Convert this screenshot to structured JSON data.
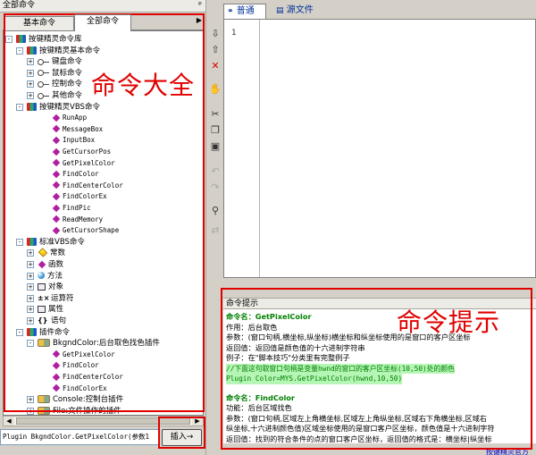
{
  "left_panel": {
    "title": "全部命令",
    "pin": "ᵖ",
    "tabs": [
      "基本命令",
      "全部命令"
    ],
    "tab_arrow": "▶"
  },
  "tree": [
    {
      "label": "按键精灵命令库",
      "level": 0,
      "icon": "multi",
      "exp": "-"
    },
    {
      "label": "按键精灵基本命令",
      "level": 1,
      "icon": "multi",
      "exp": "-"
    },
    {
      "label": "键盘命令",
      "level": 2,
      "icon": "key",
      "exp": "+"
    },
    {
      "label": "鼠标命令",
      "level": 2,
      "icon": "key",
      "exp": "+"
    },
    {
      "label": "控制命令",
      "level": 2,
      "icon": "key",
      "exp": "+"
    },
    {
      "label": "其他命令",
      "level": 2,
      "icon": "key",
      "exp": "+"
    },
    {
      "label": "按键精灵VBS命令",
      "level": 1,
      "icon": "multi",
      "exp": "-"
    },
    {
      "label": "RunApp",
      "level": 3,
      "icon": "diamond",
      "mono": true
    },
    {
      "label": "MessageBox",
      "level": 3,
      "icon": "diamond",
      "mono": true
    },
    {
      "label": "InputBox",
      "level": 3,
      "icon": "diamond",
      "mono": true
    },
    {
      "label": "GetCursorPos",
      "level": 3,
      "icon": "diamond",
      "mono": true
    },
    {
      "label": "GetPixelColor",
      "level": 3,
      "icon": "diamond",
      "mono": true
    },
    {
      "label": "FindColor",
      "level": 3,
      "icon": "diamond",
      "mono": true
    },
    {
      "label": "FindCenterColor",
      "level": 3,
      "icon": "diamond",
      "mono": true
    },
    {
      "label": "FindColorEx",
      "level": 3,
      "icon": "diamond",
      "mono": true
    },
    {
      "label": "FindPic",
      "level": 3,
      "icon": "diamond",
      "mono": true
    },
    {
      "label": "ReadMemory",
      "level": 3,
      "icon": "diamond",
      "mono": true
    },
    {
      "label": "GetCursorShape",
      "level": 3,
      "icon": "diamond",
      "mono": true
    },
    {
      "label": "标准VBS命令",
      "level": 1,
      "icon": "multi",
      "exp": "-"
    },
    {
      "label": "常数",
      "level": 2,
      "icon": "gem",
      "exp": "+"
    },
    {
      "label": "函数",
      "level": 2,
      "icon": "diamond",
      "exp": "+"
    },
    {
      "label": "方法",
      "level": 2,
      "icon": "ball",
      "exp": "+"
    },
    {
      "label": "对象",
      "level": 2,
      "icon": "box",
      "exp": "+"
    },
    {
      "label": "运算符",
      "level": 2,
      "icon": "text",
      "exp": "+",
      "glyph": "±×"
    },
    {
      "label": "属性",
      "level": 2,
      "icon": "box",
      "exp": "+"
    },
    {
      "label": "语句",
      "level": 2,
      "icon": "text",
      "exp": "+",
      "glyph": "{}"
    },
    {
      "label": "插件命令",
      "level": 1,
      "icon": "multi",
      "exp": "-"
    },
    {
      "label": "BkgndColor:后台取色找色插件",
      "level": 2,
      "icon": "plugin",
      "exp": "-"
    },
    {
      "label": "GetPixelColor",
      "level": 3,
      "icon": "diamond",
      "mono": true
    },
    {
      "label": "FindColor",
      "level": 3,
      "icon": "diamond",
      "mono": true
    },
    {
      "label": "FindCenterColor",
      "level": 3,
      "icon": "diamond",
      "mono": true
    },
    {
      "label": "FindColorEx",
      "level": 3,
      "icon": "diamond",
      "mono": true
    },
    {
      "label": "Console:控制台插件",
      "level": 2,
      "icon": "plugin",
      "exp": "+"
    },
    {
      "label": "File:文件操作的插件",
      "level": 2,
      "icon": "plugin",
      "exp": "+"
    }
  ],
  "command_line": "Plugin BkgndColor.GetPixelColor(参数1",
  "insert_button": "插入→",
  "toolbar_icons": [
    "arrow-down-icon",
    "arrow-up-icon",
    "delete-x-icon",
    "hand-icon",
    "cut-icon",
    "copy-icon",
    "paste-icon",
    "undo-icon",
    "redo-icon",
    "find-icon",
    "replace-icon"
  ],
  "right_panel": {
    "tab_normal": "普通",
    "tab_source": "源文件",
    "line_number": "1"
  },
  "hint": {
    "title": "命令提示",
    "lines": [
      {
        "text": "命令名：GetPixelColor",
        "style": "g"
      },
      {
        "text": "作用：后台取色",
        "style": ""
      },
      {
        "text": "参数：(窗口句柄,横坐标,纵坐标)横坐标和纵坐标使用的是窗口的客户区坐标",
        "style": ""
      },
      {
        "text": "返回值：返回值是颜色值的十六进制字符串",
        "style": ""
      },
      {
        "text": "例子：在\"脚本技巧\"分类里有完整例子",
        "style": ""
      },
      {
        "text": "//下面这句取窗口句柄是变量hwnd的窗口的客户区坐标(10,50)处的颜色",
        "style": "gm hilite"
      },
      {
        "text": "Plugin Color=MYS.GetPixelColor(hwnd,10,50)",
        "style": "gm hilite"
      },
      {
        "text": "",
        "style": "gap"
      },
      {
        "text": "命令名：FindColor",
        "style": "g"
      },
      {
        "text": "功能：后台区域找色",
        "style": ""
      },
      {
        "text": "参数：(窗口句柄,区域左上角横坐标,区域左上角纵坐标,区域右下角横坐标,区域右",
        "style": ""
      },
      {
        "text": "纵坐标,十六进制颜色值)区域坐标使用的是窗口客户区坐标，颜色值是十六进制字符",
        "style": ""
      },
      {
        "text": "返回值：找到的符合条件的点的窗口客户区坐标，返回值的格式是：横坐标|纵坐标",
        "style": ""
      },
      {
        "text": "果找不到符合条件的点则返回：-1|-1",
        "style": ""
      }
    ]
  },
  "bottom_link": "按键精灵官方",
  "annotations": {
    "left_label": "命令大全",
    "right_label": "命令提示"
  }
}
